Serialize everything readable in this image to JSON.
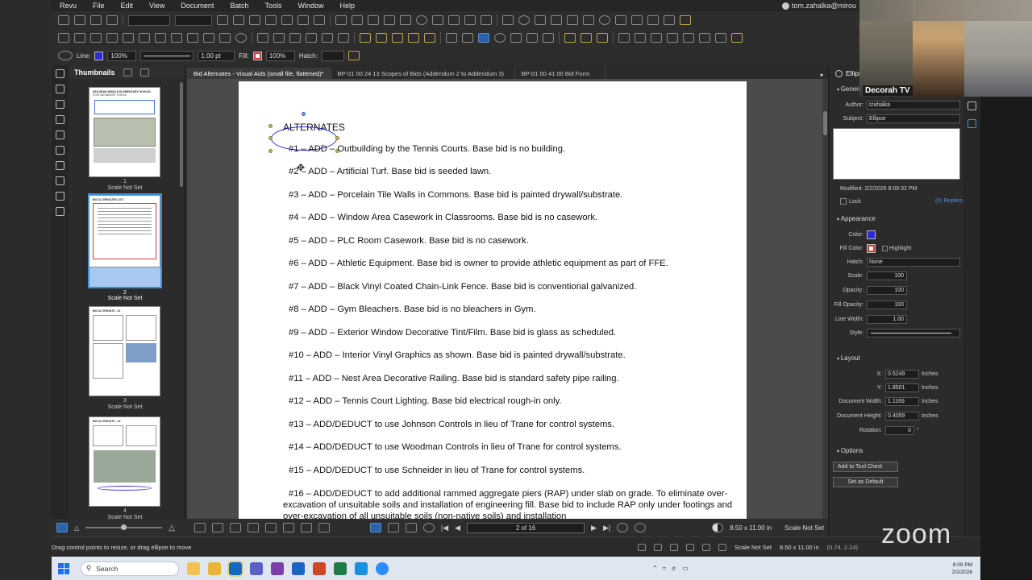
{
  "menu": {
    "items": [
      "Revu",
      "File",
      "Edit",
      "View",
      "Document",
      "Batch",
      "Tools",
      "Window",
      "Help"
    ],
    "user": "tom.zahalka@mirou"
  },
  "props_toolbar": {
    "line_label": "Line:",
    "line_opacity": "100%",
    "line_width": "1.00 pt",
    "fill_label": "Fill:",
    "fill_opacity": "100%",
    "hatch_label": "Hatch:",
    "line_color": "#2b2bd6",
    "fill_color": "#d23a3a"
  },
  "thumbnails": {
    "title": "Thumbnails",
    "pages": [
      {
        "num": "1",
        "scale": "Scale Not Set"
      },
      {
        "num": "2",
        "scale": "Scale Not Set"
      },
      {
        "num": "3",
        "scale": "Scale Not Set"
      },
      {
        "num": "4",
        "scale": "Scale Not Set"
      }
    ],
    "thumb1_title": "DECORAH MIDDLE ELEMENTARY SCHOOL",
    "thumb1_sub": "POST BID BUDGET STATUS",
    "thumb2_title": "BID ALTERNATES LIST",
    "thumb3_title": "BID ALTERNATE - 01",
    "thumb4_title": "BID ALTERNATE - 02"
  },
  "tabs": [
    {
      "label": "Bid Alternates - Visual Aids (small file, flattened)*",
      "active": true
    },
    {
      "label": "BP-01 00 24 13 Scopes of Bids (Addendum 2 to Addendum 3)",
      "active": false
    },
    {
      "label": "BP-01 00 41 00 Bid Form",
      "active": false
    }
  ],
  "document": {
    "heading": "ALTERNATES",
    "lines": [
      "#1 – ADD – Outbuilding by the Tennis Courts. Base bid is no building.",
      "#2 – ADD – Artificial Turf.  Base bid is seeded lawn.",
      "#3 – ADD – Porcelain Tile Walls in Commons. Base bid is painted drywall/substrate.",
      "#4 – ADD – Window Area Casework in Classrooms.  Base bid is no casework.",
      "#5 – ADD – PLC Room Casework. Base bid is no casework.",
      "#6 – ADD – Athletic Equipment. Base bid is owner to provide athletic equipment as part of FFE.",
      "#7 – ADD – Black Vinyl Coated Chain-Link Fence. Base bid is conventional galvanized.",
      "#8 – ADD – Gym Bleachers. Base bid is no bleachers in Gym.",
      "#9 – ADD – Exterior Window Decorative Tint/Film. Base bid is glass as scheduled.",
      "#10 – ADD – Interior Vinyl Graphics as shown.  Base bid is painted drywall/substrate.",
      "#11 – ADD – Nest Area Decorative Railing.  Base bid is standard safety pipe railing.",
      "#12 – ADD – Tennis Court Lighting. Base bid electrical rough-in only.",
      "#13 – ADD/DEDUCT to use Johnson Controls in lieu of Trane for control systems.",
      "#14 – ADD/DEDUCT to use Woodman Controls in lieu of Trane for control systems.",
      "#15 – ADD/DEDUCT to use Schneider in lieu of Trane for control systems."
    ],
    "line16": "#16 – ADD/DEDUCT to add additional rammed aggregate piers (RAP) under slab on grade. To eliminate over-excavation of unsuitable soils and installation of engineering fill. Base bid to include RAP only under footings and over-excavation of all unsuitable soils (non-native soils) and installation"
  },
  "navbar": {
    "page_indicator": "2 of 16",
    "page_size": "8.50 x 11.00 in",
    "scale": "Scale Not Set"
  },
  "properties": {
    "title": "Ellipse",
    "general_section": "General",
    "author_label": "Author:",
    "author_value": "tzahalka",
    "subject_label": "Subject:",
    "subject_value": "Ellipse",
    "modified": "Modified: 2/2/2026 8:09:32 PM",
    "lock_label": "Lock",
    "replies": "(0) Replies",
    "appearance_section": "Appearance",
    "color_label": "Color:",
    "fill_color_label": "Fill Color:",
    "highlight_label": "Highlight",
    "hatch_label": "Hatch:",
    "hatch_value": "None",
    "scale_label": "Scale:",
    "scale_value": "100",
    "opacity_label": "Opacity:",
    "opacity_value": "100",
    "fill_opacity_label": "Fill Opacity:",
    "fill_opacity_value": "100",
    "line_width_label": "Line Width:",
    "line_width_value": "1.00",
    "style_label": "Style:",
    "layout_section": "Layout",
    "x_label": "X:",
    "x_value": "0.5249",
    "x_unit": "Inches",
    "y_label": "Y:",
    "y_value": "1.8501",
    "y_unit": "Inches",
    "doc_width_label": "Document Width:",
    "doc_width_value": "1.1169",
    "doc_width_unit": "Inches",
    "doc_height_label": "Document Height:",
    "doc_height_value": "0.4059",
    "doc_height_unit": "Inches",
    "rotation_label": "Rotation:",
    "rotation_value": "0",
    "rotation_unit": "°",
    "options_section": "Options",
    "add_toolchest": "Add to Tool Chest",
    "set_default": "Set as Default"
  },
  "video": {
    "label": "Decorah TV"
  },
  "zoom_logo": "zoom",
  "status": {
    "hint": "Drag control points to resize, or drag ellipse to move",
    "scale": "Scale Not Set",
    "size": "8.50 x 11.00 in",
    "coords": "(0.74, 2.24)"
  },
  "taskbar": {
    "search_placeholder": "Search",
    "time": "8:09 PM",
    "date": "2/2/2026"
  }
}
